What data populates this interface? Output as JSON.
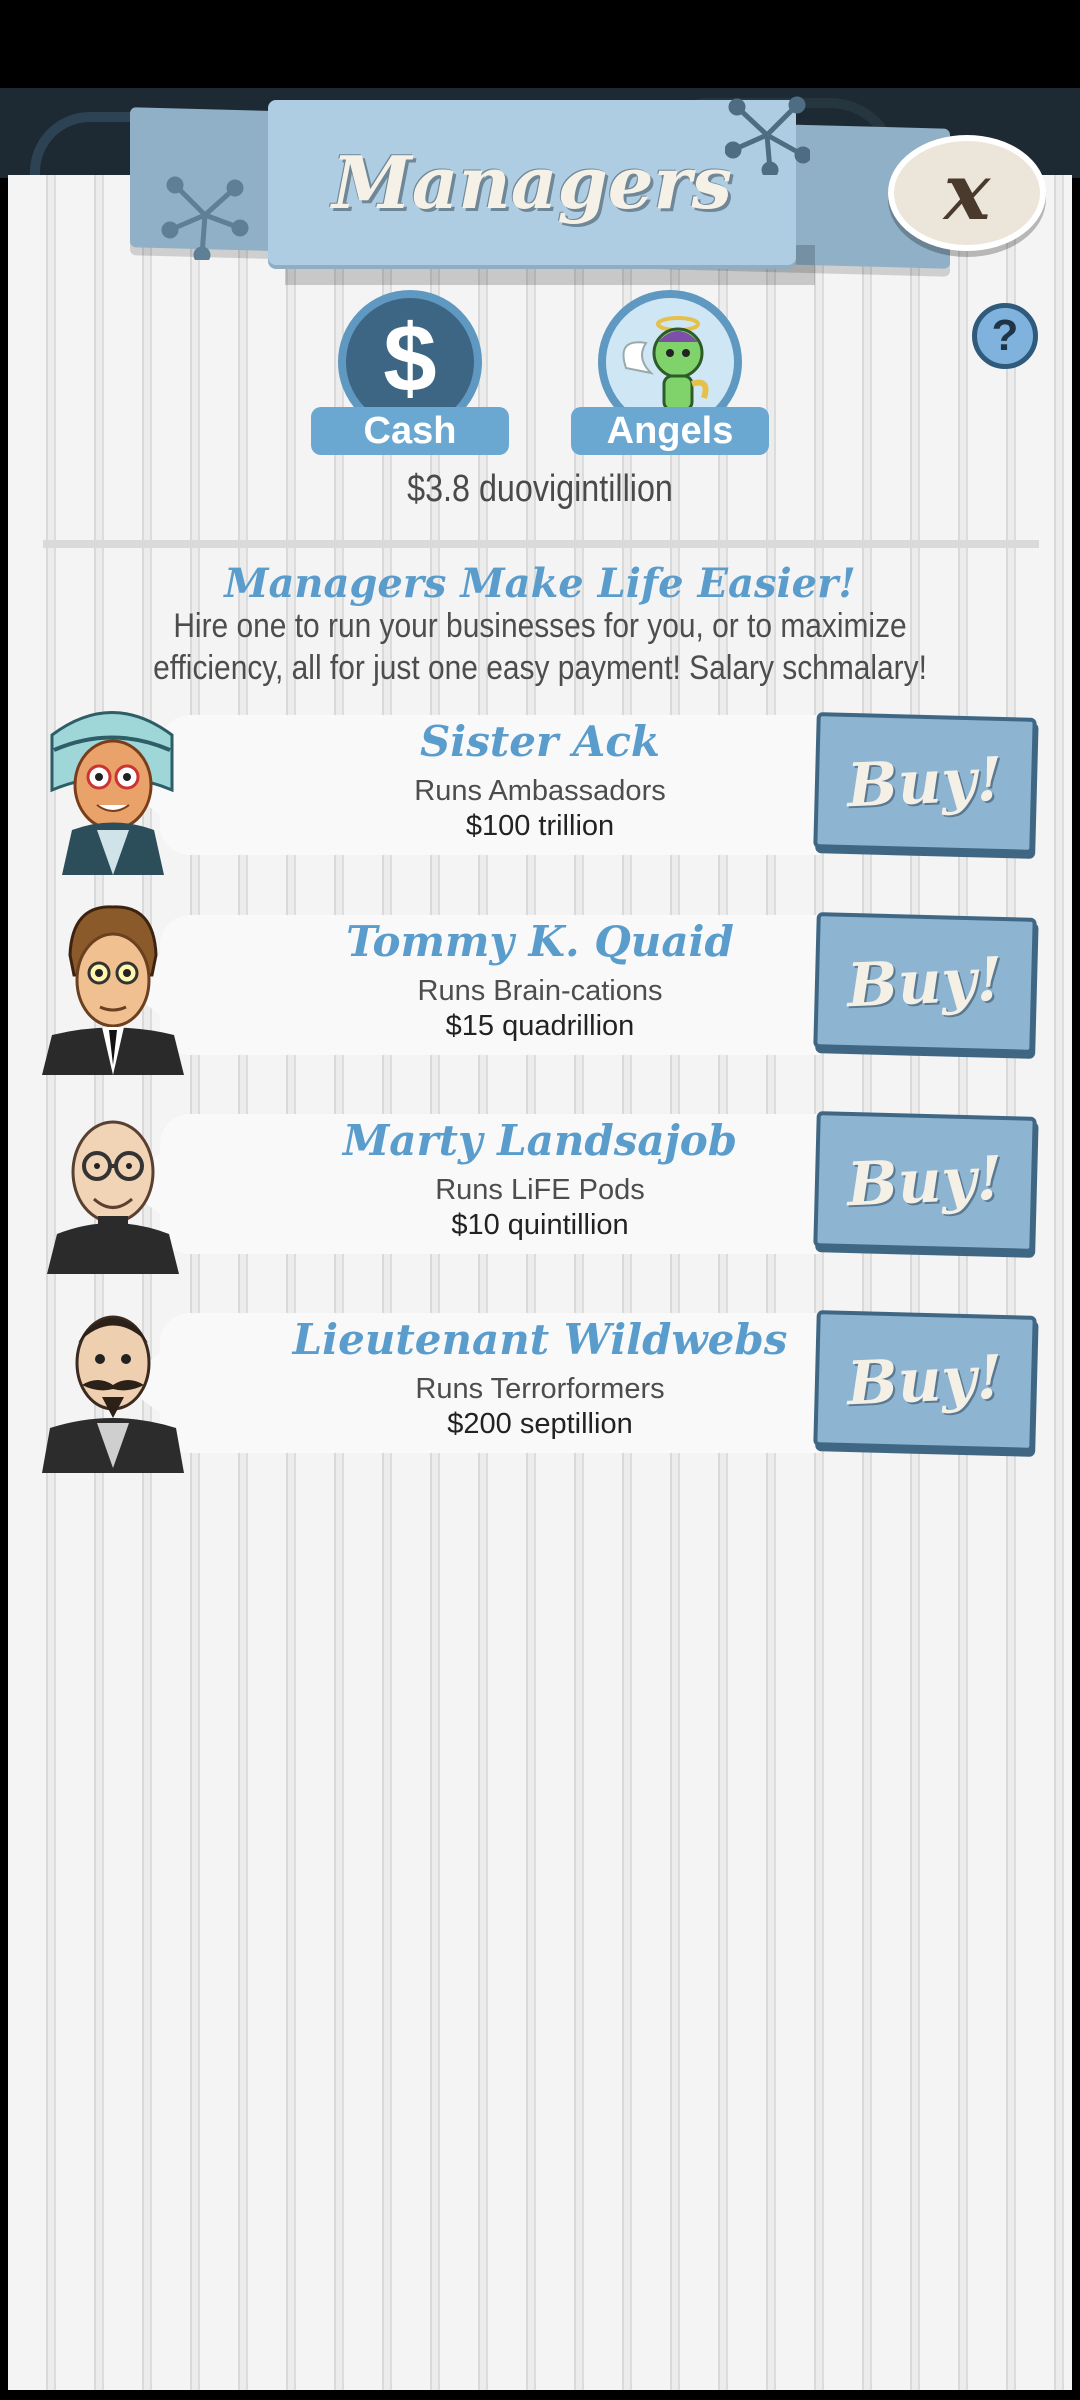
{
  "header": {
    "title": "Managers",
    "close_label": "x",
    "help_label": "?"
  },
  "currency": {
    "tabs": [
      {
        "label": "Cash",
        "icon": "dollar-icon",
        "glyph": "$"
      },
      {
        "label": "Angels",
        "icon": "angel-icon"
      }
    ],
    "balance": "$3.8 duovigintillion"
  },
  "intro": {
    "headline": "Managers Make Life Easier!",
    "text": "Hire one to run your businesses for you, or to maximize efficiency, all for just one easy payment! Salary schmalary!"
  },
  "managers": [
    {
      "name": "Sister Ack",
      "runs": "Runs Ambassadors",
      "cost": "$100 trillion",
      "buy_label": "Buy!"
    },
    {
      "name": "Tommy K. Quaid",
      "runs": "Runs Brain-cations",
      "cost": "$15 quadrillion",
      "buy_label": "Buy!"
    },
    {
      "name": "Marty Landsajob",
      "runs": "Runs LiFE Pods",
      "cost": "$10 quintillion",
      "buy_label": "Buy!"
    },
    {
      "name": "Lieutenant Wildwebs",
      "runs": "Runs Terrorformers",
      "cost": "$200 septillion",
      "buy_label": "Buy!"
    }
  ],
  "colors": {
    "accent": "#5a9dcc",
    "button": "#8db5d2",
    "banner": "#aecde3"
  }
}
